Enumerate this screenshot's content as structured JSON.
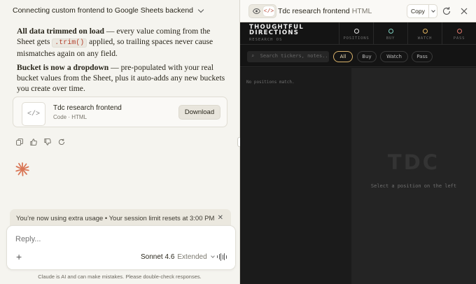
{
  "conversation": {
    "title": "Connecting custom frontend to Google Sheets backend"
  },
  "message": {
    "p1_bold": "All data trimmed on load",
    "p1_text_a": " — every value coming from the Sheet gets ",
    "p1_code": ".trim()",
    "p1_text_b": " applied, so trailing spaces never cause mismatches again on any field.",
    "p2_bold": "Bucket is now a dropdown",
    "p2_text": " — pre-populated with your real bucket values from the Sheet, plus it auto-adds any new buckets you create over time."
  },
  "artifact_card": {
    "icon": "</>",
    "title": "Tdc research frontend",
    "type": "Code",
    "lang": "HTML",
    "download_label": "Download"
  },
  "message_actions": [
    "copy-icon",
    "thumbs-up-icon",
    "thumbs-down-icon",
    "retry-icon"
  ],
  "notice": {
    "text": "You’re now using extra usage • Your session limit resets at 3:00 PM"
  },
  "composer": {
    "placeholder": "Reply...",
    "model": "Sonnet 4.6",
    "mode": "Extended"
  },
  "disclaimer": "Claude is AI and can make mistakes. Please double-check responses.",
  "artifact_panel": {
    "title": "Tdc research frontend",
    "lang": "HTML",
    "copy_label": "Copy",
    "preview_icon": "eye-icon",
    "code_icon": "</>"
  },
  "preview_app": {
    "logo_line1": "THOUGHTFUL",
    "logo_line2": "DIRECTIONS",
    "logo_sub": "RESEARCH OS",
    "stats": [
      {
        "count": "0",
        "label": "POSITIONS",
        "color": "#e8e8e8"
      },
      {
        "count": "0",
        "label": "BUY",
        "color": "#7fd0c0"
      },
      {
        "count": "0",
        "label": "WATCH",
        "color": "#e2b45f"
      },
      {
        "count": "0",
        "label": "PASS",
        "color": "#e0776b"
      }
    ],
    "search_placeholder": "Search tickers, notes...",
    "filters": [
      "All",
      "Buy",
      "Watch",
      "Pass"
    ],
    "active_filter": "All",
    "empty_text": "No positions match.",
    "watermark": "TDC",
    "select_hint": "Select a position on the left"
  },
  "colors": {
    "accent": "#d97757",
    "sidebar_bg": "#f5f4ef",
    "app_bg": "#141414"
  }
}
